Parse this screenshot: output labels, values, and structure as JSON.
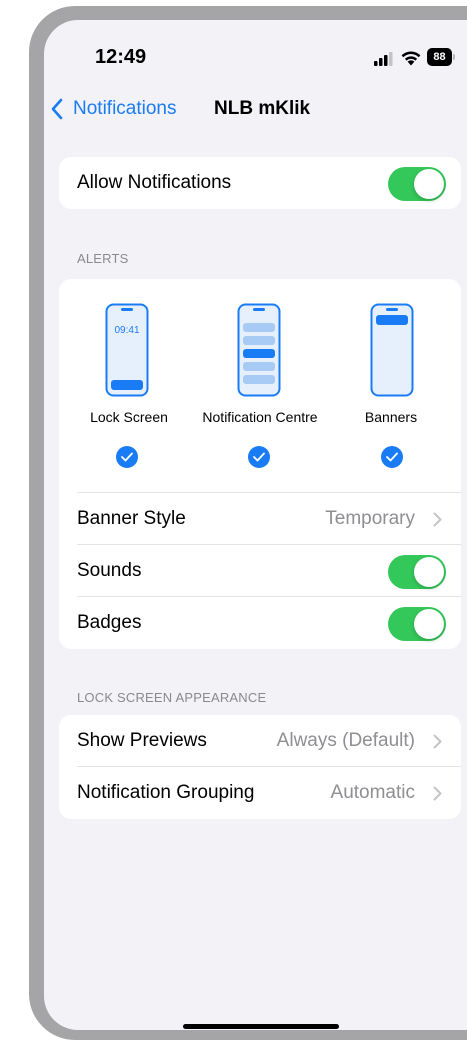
{
  "status_bar": {
    "time": "12:49",
    "battery": "88"
  },
  "nav": {
    "back_label": "Notifications",
    "title": "NLB mKlik"
  },
  "allow_notifications": {
    "label": "Allow Notifications",
    "enabled": true
  },
  "alerts": {
    "header": "ALERTS",
    "options": [
      {
        "label": "Lock Screen",
        "preview_time": "09:41",
        "selected": true
      },
      {
        "label": "Notification Centre",
        "selected": true
      },
      {
        "label": "Banners",
        "selected": true
      }
    ],
    "banner_style": {
      "label": "Banner Style",
      "value": "Temporary"
    },
    "sounds": {
      "label": "Sounds",
      "enabled": true
    },
    "badges": {
      "label": "Badges",
      "enabled": true
    }
  },
  "lock_screen_appearance": {
    "header": "LOCK SCREEN APPEARANCE",
    "show_previews": {
      "label": "Show Previews",
      "value": "Always (Default)"
    },
    "notification_grouping": {
      "label": "Notification Grouping",
      "value": "Automatic"
    }
  },
  "colors": {
    "accent": "#1a7cf5",
    "toggle_on": "#34c759",
    "background": "#f2f2f7"
  }
}
